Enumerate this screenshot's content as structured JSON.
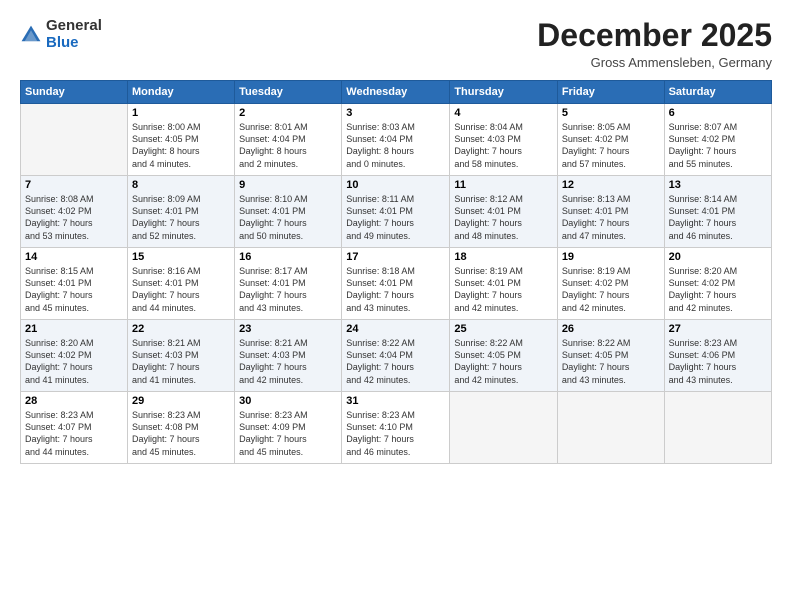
{
  "header": {
    "logo": {
      "line1": "General",
      "line2": "Blue"
    },
    "title": "December 2025",
    "location": "Gross Ammensleben, Germany"
  },
  "calendar": {
    "days_of_week": [
      "Sunday",
      "Monday",
      "Tuesday",
      "Wednesday",
      "Thursday",
      "Friday",
      "Saturday"
    ],
    "weeks": [
      [
        {
          "day": "",
          "info": ""
        },
        {
          "day": "1",
          "info": "Sunrise: 8:00 AM\nSunset: 4:05 PM\nDaylight: 8 hours\nand 4 minutes."
        },
        {
          "day": "2",
          "info": "Sunrise: 8:01 AM\nSunset: 4:04 PM\nDaylight: 8 hours\nand 2 minutes."
        },
        {
          "day": "3",
          "info": "Sunrise: 8:03 AM\nSunset: 4:04 PM\nDaylight: 8 hours\nand 0 minutes."
        },
        {
          "day": "4",
          "info": "Sunrise: 8:04 AM\nSunset: 4:03 PM\nDaylight: 7 hours\nand 58 minutes."
        },
        {
          "day": "5",
          "info": "Sunrise: 8:05 AM\nSunset: 4:02 PM\nDaylight: 7 hours\nand 57 minutes."
        },
        {
          "day": "6",
          "info": "Sunrise: 8:07 AM\nSunset: 4:02 PM\nDaylight: 7 hours\nand 55 minutes."
        }
      ],
      [
        {
          "day": "7",
          "info": "Sunrise: 8:08 AM\nSunset: 4:02 PM\nDaylight: 7 hours\nand 53 minutes."
        },
        {
          "day": "8",
          "info": "Sunrise: 8:09 AM\nSunset: 4:01 PM\nDaylight: 7 hours\nand 52 minutes."
        },
        {
          "day": "9",
          "info": "Sunrise: 8:10 AM\nSunset: 4:01 PM\nDaylight: 7 hours\nand 50 minutes."
        },
        {
          "day": "10",
          "info": "Sunrise: 8:11 AM\nSunset: 4:01 PM\nDaylight: 7 hours\nand 49 minutes."
        },
        {
          "day": "11",
          "info": "Sunrise: 8:12 AM\nSunset: 4:01 PM\nDaylight: 7 hours\nand 48 minutes."
        },
        {
          "day": "12",
          "info": "Sunrise: 8:13 AM\nSunset: 4:01 PM\nDaylight: 7 hours\nand 47 minutes."
        },
        {
          "day": "13",
          "info": "Sunrise: 8:14 AM\nSunset: 4:01 PM\nDaylight: 7 hours\nand 46 minutes."
        }
      ],
      [
        {
          "day": "14",
          "info": "Sunrise: 8:15 AM\nSunset: 4:01 PM\nDaylight: 7 hours\nand 45 minutes."
        },
        {
          "day": "15",
          "info": "Sunrise: 8:16 AM\nSunset: 4:01 PM\nDaylight: 7 hours\nand 44 minutes."
        },
        {
          "day": "16",
          "info": "Sunrise: 8:17 AM\nSunset: 4:01 PM\nDaylight: 7 hours\nand 43 minutes."
        },
        {
          "day": "17",
          "info": "Sunrise: 8:18 AM\nSunset: 4:01 PM\nDaylight: 7 hours\nand 43 minutes."
        },
        {
          "day": "18",
          "info": "Sunrise: 8:19 AM\nSunset: 4:01 PM\nDaylight: 7 hours\nand 42 minutes."
        },
        {
          "day": "19",
          "info": "Sunrise: 8:19 AM\nSunset: 4:02 PM\nDaylight: 7 hours\nand 42 minutes."
        },
        {
          "day": "20",
          "info": "Sunrise: 8:20 AM\nSunset: 4:02 PM\nDaylight: 7 hours\nand 42 minutes."
        }
      ],
      [
        {
          "day": "21",
          "info": "Sunrise: 8:20 AM\nSunset: 4:02 PM\nDaylight: 7 hours\nand 41 minutes."
        },
        {
          "day": "22",
          "info": "Sunrise: 8:21 AM\nSunset: 4:03 PM\nDaylight: 7 hours\nand 41 minutes."
        },
        {
          "day": "23",
          "info": "Sunrise: 8:21 AM\nSunset: 4:03 PM\nDaylight: 7 hours\nand 42 minutes."
        },
        {
          "day": "24",
          "info": "Sunrise: 8:22 AM\nSunset: 4:04 PM\nDaylight: 7 hours\nand 42 minutes."
        },
        {
          "day": "25",
          "info": "Sunrise: 8:22 AM\nSunset: 4:05 PM\nDaylight: 7 hours\nand 42 minutes."
        },
        {
          "day": "26",
          "info": "Sunrise: 8:22 AM\nSunset: 4:05 PM\nDaylight: 7 hours\nand 43 minutes."
        },
        {
          "day": "27",
          "info": "Sunrise: 8:23 AM\nSunset: 4:06 PM\nDaylight: 7 hours\nand 43 minutes."
        }
      ],
      [
        {
          "day": "28",
          "info": "Sunrise: 8:23 AM\nSunset: 4:07 PM\nDaylight: 7 hours\nand 44 minutes."
        },
        {
          "day": "29",
          "info": "Sunrise: 8:23 AM\nSunset: 4:08 PM\nDaylight: 7 hours\nand 45 minutes."
        },
        {
          "day": "30",
          "info": "Sunrise: 8:23 AM\nSunset: 4:09 PM\nDaylight: 7 hours\nand 45 minutes."
        },
        {
          "day": "31",
          "info": "Sunrise: 8:23 AM\nSunset: 4:10 PM\nDaylight: 7 hours\nand 46 minutes."
        },
        {
          "day": "",
          "info": ""
        },
        {
          "day": "",
          "info": ""
        },
        {
          "day": "",
          "info": ""
        }
      ]
    ]
  }
}
